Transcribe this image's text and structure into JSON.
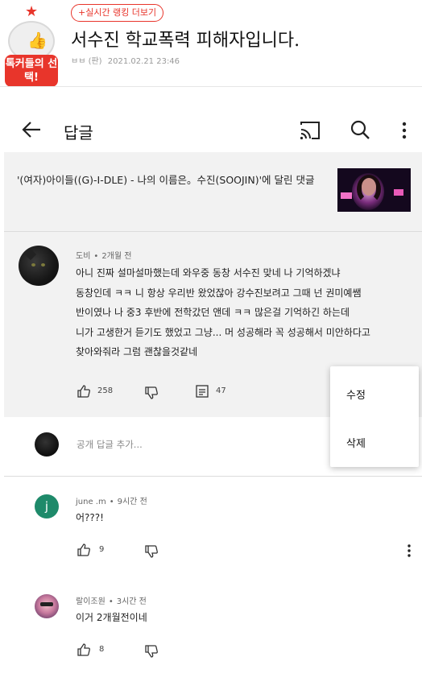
{
  "post": {
    "badge_label": "톡커들의 선택!",
    "rank_link": "+실시간 랭킹 더보기",
    "title": "서수진 학교폭력 피해자입니다.",
    "author": "ㅂㅂ (판)",
    "date": "2021.02.21 23:46"
  },
  "appbar": {
    "title": "답글",
    "icons": [
      "back-arrow-icon",
      "cast-icon",
      "search-icon",
      "more-vert-icon"
    ]
  },
  "video": {
    "title": "'(여자)아이들((G)-I-DLE) - 나의 이름은。수진(SOOJIN)'에 달린 댓글"
  },
  "main_comment": {
    "author": "도비",
    "time": "2개월 전",
    "lines": [
      "아니 진짜 설마설마했는데 와우중 동창 서수진 맞네 나 기억하겠냐",
      "동창인데 ㅋㅋ 니 항상 우리반 왔었잖아 강수진보려고 그때 넌 권미예쌤",
      "반이였나  나 중3 후반에 전학갔던 앤데 ㅋㅋ 많은걸 기억하긴 하는데",
      "니가 고생한거 듣기도 했었고 그냥... 머 성공해라 꼭 성공해서 미안하다고",
      "찾아와줘라 그럼 괜찮을것같네"
    ],
    "likes": "258",
    "replies": "47"
  },
  "reply_input": {
    "placeholder": "공개 답글 추가..."
  },
  "menu": {
    "edit": "수정",
    "delete": "삭제"
  },
  "replies": [
    {
      "avatar_letter": "j",
      "author": "june .m",
      "time": "9시간 전",
      "text": "어???!",
      "likes": "9"
    },
    {
      "author": "랄이조원",
      "time": "3시간 전",
      "text": "이거 2개월전이네",
      "likes": "8"
    }
  ],
  "colors": {
    "accent": "#e8352b",
    "gray_bg": "#f2f2f2",
    "reply_avatar": "#1e8a6a"
  }
}
